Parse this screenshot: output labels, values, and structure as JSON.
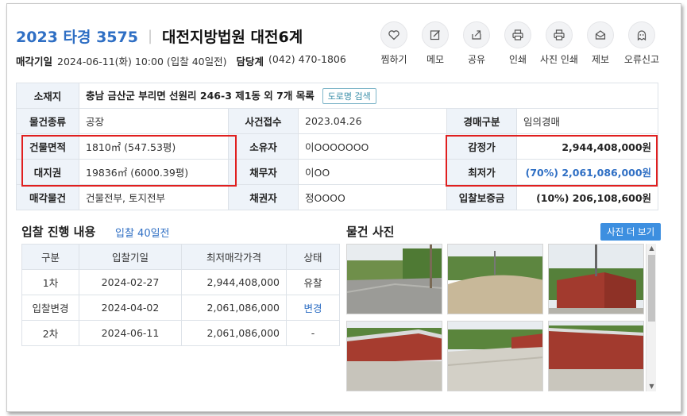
{
  "header": {
    "case_no": "2023 타경 3575",
    "separator": "|",
    "court": "대전지방법원 대전6계"
  },
  "subline": {
    "date_label": "매각기일",
    "date_value": "2024-06-11(화) 10:00 (입찰 40일전)",
    "contact_label": "담당계",
    "contact_value": "(042) 470-1806"
  },
  "actions": [
    {
      "label": "찜하기",
      "icon": "heart-icon"
    },
    {
      "label": "메모",
      "icon": "memo-icon"
    },
    {
      "label": "공유",
      "icon": "share-icon"
    },
    {
      "label": "인쇄",
      "icon": "print-icon"
    },
    {
      "label": "사진 인쇄",
      "icon": "photo-print-icon"
    },
    {
      "label": "제보",
      "icon": "mail-icon"
    },
    {
      "label": "오류신고",
      "icon": "ghost-icon"
    }
  ],
  "info": {
    "location_label": "소재지",
    "location_value": "충남 금산군 부리면 선원리 246-3 제1동 외 7개 목록",
    "road_btn": "도로명 검색",
    "type_label": "물건종류",
    "type_value": "공장",
    "received_label": "사건접수",
    "received_value": "2023.04.26",
    "auction_type_label": "경매구분",
    "auction_type_value": "임의경매",
    "bldg_area_label": "건물면적",
    "bldg_area_value": "1810㎡ (547.53평)",
    "owner_label": "소유자",
    "owner_value": "이OOOOOOO",
    "appraisal_label": "감정가",
    "appraisal_value": "2,944,408,000원",
    "land_label": "대지권",
    "land_value": "19836㎡ (6000.39평)",
    "debtor_label": "채무자",
    "debtor_value": "이OO",
    "min_label": "최저가",
    "min_value": "(70%) 2,061,086,000원",
    "sale_label": "매각물건",
    "sale_value": "건물전부, 토지전부",
    "creditor_label": "채권자",
    "creditor_value": "정OOOO",
    "deposit_label": "입찰보증금",
    "deposit_value": "(10%) 206,108,600원"
  },
  "bid_section": {
    "title": "입찰 진행 내용",
    "sub": "입찰 40일전",
    "headers": [
      "구분",
      "입찰기일",
      "최저매각가격",
      "상태"
    ],
    "rows": [
      [
        "1차",
        "2024-02-27",
        "2,944,408,000",
        "유찰"
      ],
      [
        "입찰변경",
        "2024-04-02",
        "2,061,086,000",
        "변경"
      ],
      [
        "2차",
        "2024-06-11",
        "2,061,086,000",
        "-"
      ]
    ]
  },
  "photo_section": {
    "title": "물건 사진",
    "more_btn": "사진 더 보기"
  },
  "colors": {
    "accent": "#2f6fc4",
    "highlight_border": "#e01f1f",
    "header_bg": "#eef3f9",
    "more_btn_bg": "#3d8fe0"
  }
}
